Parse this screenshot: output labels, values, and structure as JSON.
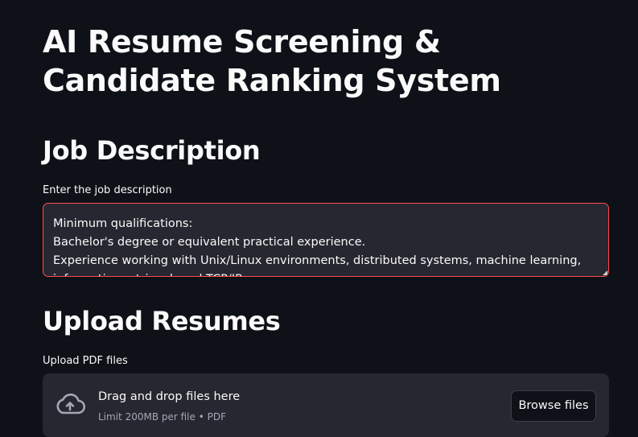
{
  "app": {
    "title": "AI Resume Screening & Candidate Ranking System"
  },
  "job_description": {
    "heading": "Job Description",
    "label": "Enter the job description",
    "value": "Minimum qualifications:\nBachelor's degree or equivalent practical experience.\nExperience working with Unix/Linux environments, distributed systems, machine learning,\ninformation retrieval, and TCP/IP."
  },
  "upload": {
    "heading": "Upload Resumes",
    "label": "Upload PDF files",
    "dropzone_text": "Drag and drop files here",
    "limit_text": "Limit 200MB per file • PDF",
    "browse_label": "Browse files",
    "icon": "cloud-upload-icon"
  },
  "colors": {
    "background": "#0e1117",
    "surface": "#262730",
    "accent_border": "#ff4b4b",
    "muted_text": "#a3a8b4"
  }
}
